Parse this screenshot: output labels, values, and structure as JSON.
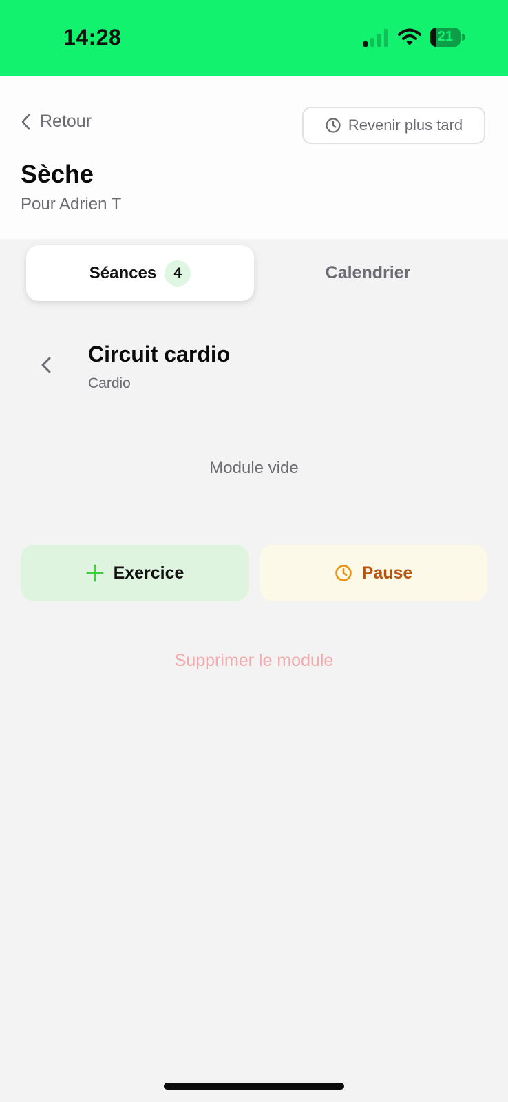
{
  "status_bar": {
    "time": "14:28",
    "battery_percent": "21",
    "signal_bars_on": 1,
    "signal_bars_total": 4,
    "battery_level": 0.21,
    "icons": [
      "signal-icon",
      "wifi-icon",
      "battery-icon"
    ]
  },
  "header": {
    "back_label": "Retour",
    "later_label": "Revenir plus tard",
    "title": "Sèche",
    "subtitle": "Pour Adrien T"
  },
  "tabs": [
    {
      "label": "Séances",
      "badge": "4",
      "selected": true
    },
    {
      "label": "Calendrier",
      "selected": false
    }
  ],
  "module": {
    "title": "Circuit cardio",
    "category": "Cardio",
    "empty_text": "Module vide",
    "add_exercise_label": "Exercice",
    "pause_label": "Pause",
    "delete_label": "Supprimer le module"
  },
  "colors": {
    "status_bar_bg": "#13f26f",
    "accent_green": "#3ccf3c",
    "pause_orange": "#e89312",
    "pause_text": "#b4560f",
    "delete_pink": "#f3a9ad"
  }
}
